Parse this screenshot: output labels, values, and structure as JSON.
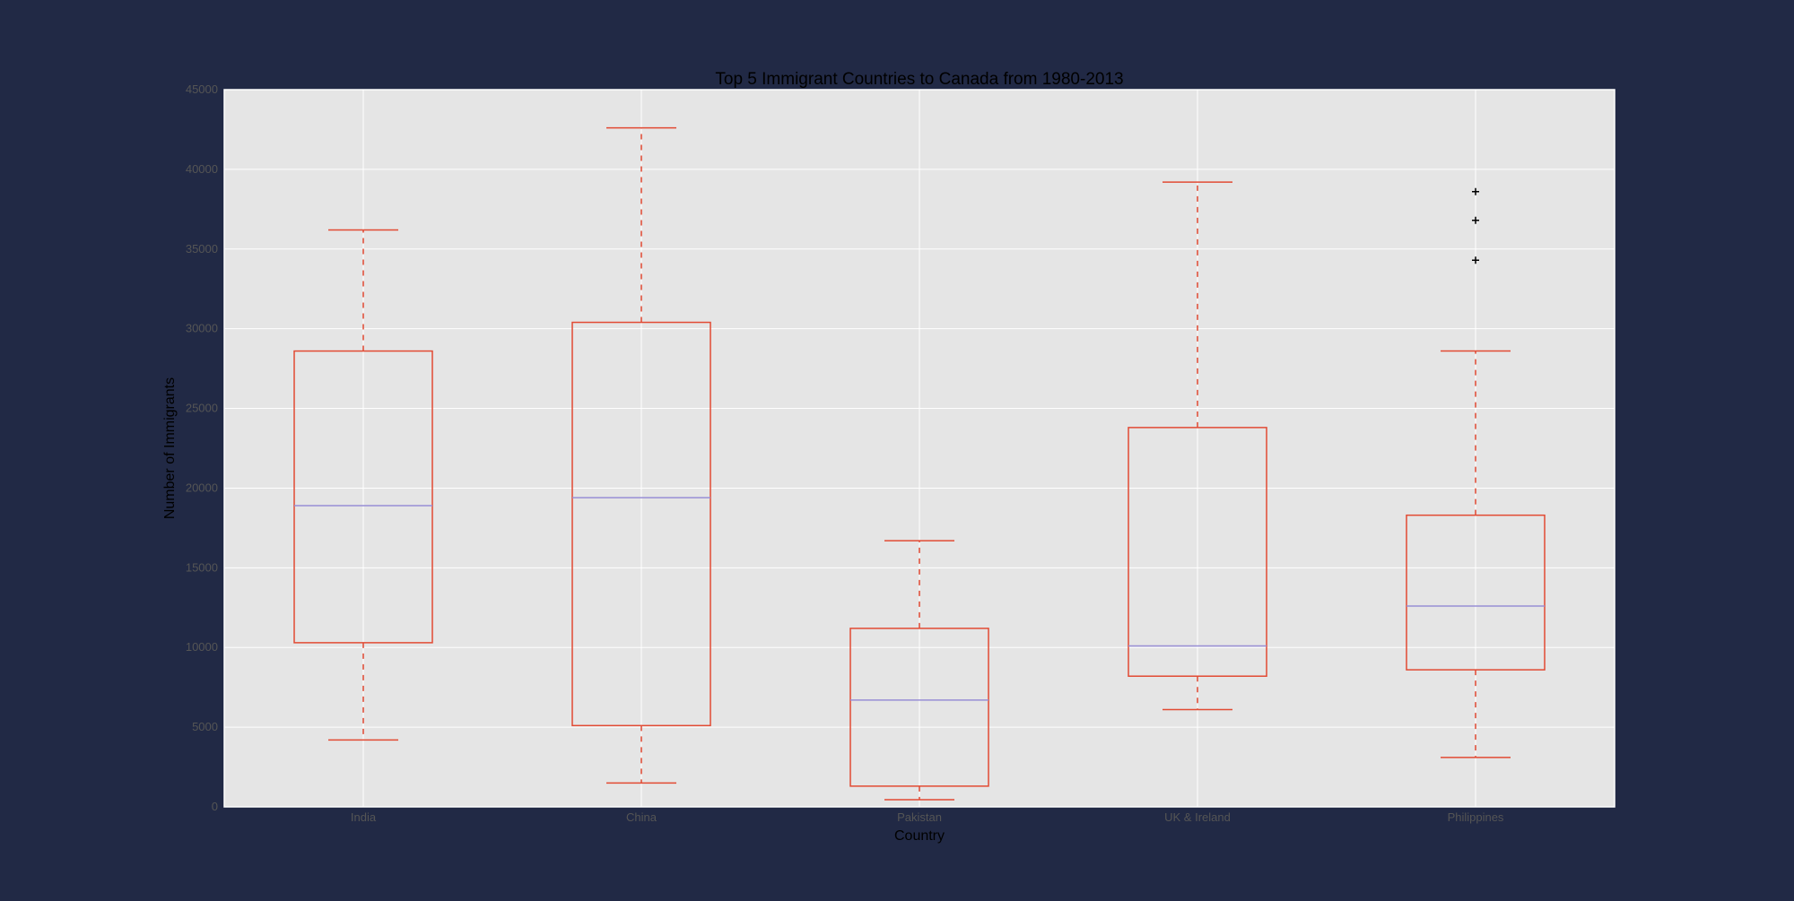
{
  "colors": {
    "page_background": "#212945",
    "plot_background": "#E5E5E5",
    "grid": "#FFFFFF",
    "box": "#E24A33",
    "median": "#8EBA42",
    "median_line": "#988ED5",
    "outlier": "#000000"
  },
  "chart_data": {
    "type": "box",
    "title": "Top 5 Immigrant Countries to Canada from 1980-2013",
    "xlabel": "Country",
    "ylabel": "Number of Immigrants",
    "ylim": [
      0,
      45000
    ],
    "yticks": [
      0,
      5000,
      10000,
      15000,
      20000,
      25000,
      30000,
      35000,
      40000,
      45000
    ],
    "grid": true,
    "categories": [
      "India",
      "China",
      "Pakistan",
      "UK & Ireland",
      "Philippines"
    ],
    "boxes": [
      {
        "name": "India",
        "whisker_low": 4200,
        "q1": 10300,
        "median": 18900,
        "q3": 28600,
        "whisker_high": 36200,
        "outliers": []
      },
      {
        "name": "China",
        "whisker_low": 1500,
        "q1": 5100,
        "median": 19400,
        "q3": 30400,
        "whisker_high": 42600,
        "outliers": []
      },
      {
        "name": "Pakistan",
        "whisker_low": 450,
        "q1": 1300,
        "median": 6700,
        "q3": 11200,
        "whisker_high": 16700,
        "outliers": []
      },
      {
        "name": "UK & Ireland",
        "whisker_low": 6100,
        "q1": 8200,
        "median": 10100,
        "q3": 23800,
        "whisker_high": 39200,
        "outliers": []
      },
      {
        "name": "Philippines",
        "whisker_low": 3100,
        "q1": 8600,
        "median": 12600,
        "q3": 18300,
        "whisker_high": 28600,
        "outliers": [
          34300,
          36800,
          38600
        ]
      }
    ]
  }
}
